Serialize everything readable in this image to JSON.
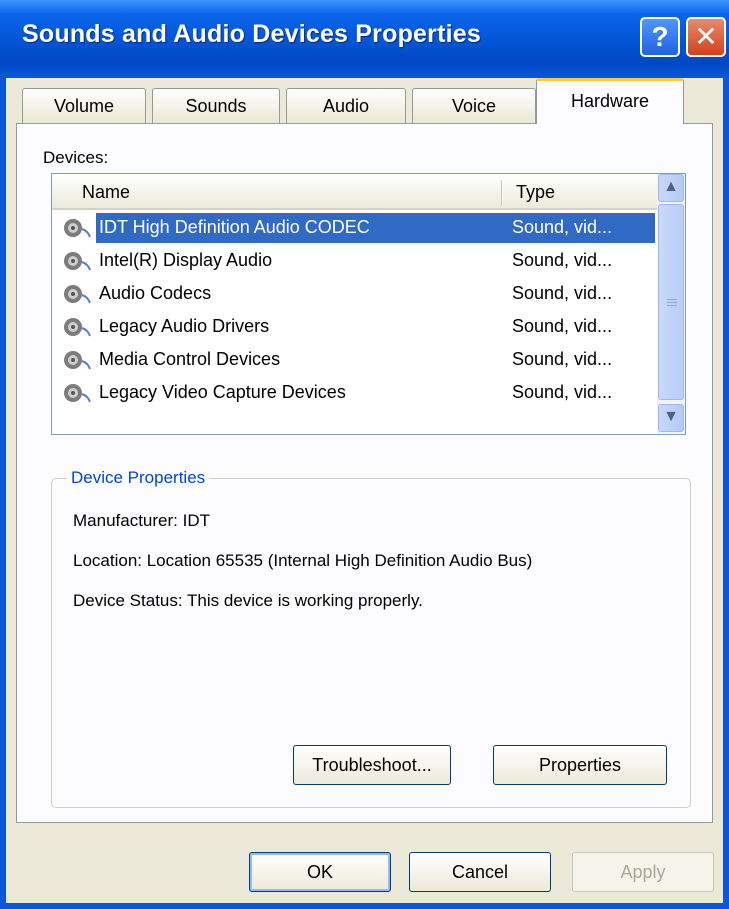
{
  "window": {
    "title": "Sounds and Audio Devices Properties"
  },
  "titlebar_buttons": {
    "help": "?",
    "close": "✕"
  },
  "tabs": [
    "Volume",
    "Sounds",
    "Audio",
    "Voice",
    "Hardware"
  ],
  "active_tab": "Hardware",
  "devices": {
    "label": "Devices:",
    "columns": {
      "name": "Name",
      "type": "Type"
    },
    "rows": [
      {
        "name": "IDT High Definition Audio CODEC",
        "type": "Sound, vid...",
        "selected": true
      },
      {
        "name": "Intel(R) Display Audio",
        "type": "Sound, vid..."
      },
      {
        "name": "Audio Codecs",
        "type": "Sound, vid..."
      },
      {
        "name": "Legacy Audio Drivers",
        "type": "Sound, vid..."
      },
      {
        "name": "Media Control Devices",
        "type": "Sound, vid..."
      },
      {
        "name": "Legacy Video Capture Devices",
        "type": "Sound, vid..."
      }
    ]
  },
  "device_properties": {
    "title": "Device Properties",
    "manufacturer": "Manufacturer: IDT",
    "location": "Location: Location 65535 (Internal High Definition Audio Bus)",
    "status": "Device Status: This device is working properly."
  },
  "panel_buttons": {
    "troubleshoot": "Troubleshoot...",
    "properties": "Properties"
  },
  "dialog_buttons": {
    "ok": "OK",
    "cancel": "Cancel",
    "apply": "Apply"
  },
  "colors": {
    "titlebar": "#0a58d8",
    "selection": "#316ac5",
    "group_title": "#0046d5",
    "tab_highlight": "#ffc83c"
  }
}
